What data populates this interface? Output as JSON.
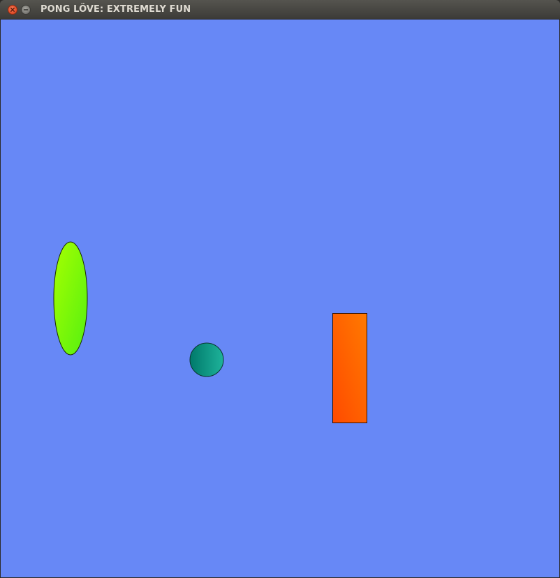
{
  "window": {
    "title": "PONG LÖVE: EXTREMELY FUN",
    "buttons": [
      "close-icon",
      "minimize-icon"
    ]
  },
  "game": {
    "background": "#6788f6",
    "left_paddle": {
      "shape": "ellipse",
      "gradient": [
        "#a6ff00",
        "#55f011"
      ],
      "stroke": "#1a2a00"
    },
    "ball": {
      "shape": "circle",
      "gradient": [
        "#00796b",
        "#1eb39a"
      ],
      "stroke": "#0b3530"
    },
    "right_paddle": {
      "shape": "rectangle",
      "gradient": [
        "#ff7a00",
        "#ff4a00"
      ],
      "stroke": "#331100"
    }
  }
}
